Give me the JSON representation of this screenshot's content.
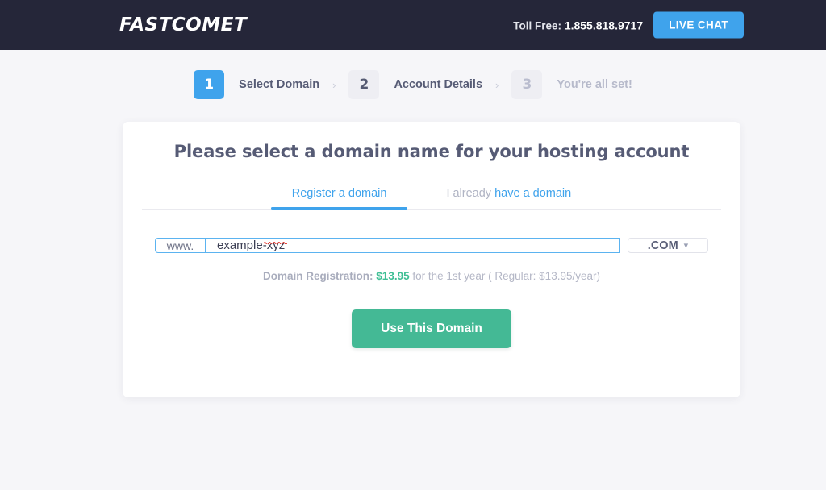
{
  "header": {
    "logo_text": "FASTCOMET",
    "tollfree_label": "Toll Free:",
    "tollfree_number": "1.855.818.9717",
    "live_chat_label": "LIVE CHAT",
    "bar_color": "#252639",
    "accent_blue": "#3fa3ec"
  },
  "steps": [
    {
      "number": "1",
      "label": "Select Domain",
      "state": "active"
    },
    {
      "number": "2",
      "label": "Account Details",
      "state": "idle"
    },
    {
      "number": "3",
      "label": "You're all set!",
      "state": "upcoming"
    }
  ],
  "step_separator": "›",
  "card": {
    "title": "Please select a domain name for your hosting account",
    "tabs": [
      {
        "label": "Register a domain",
        "active": true
      },
      {
        "label_muted": "I already",
        "label_link": "have a domain",
        "active": false
      }
    ],
    "domain_form": {
      "prefix": "www.",
      "value": "example-xyz",
      "placeholder": "",
      "tld_selected": ".COM",
      "tld_chevron": "chevron-down-icon",
      "spellcheck_flagged": true
    },
    "price_line": {
      "label": "Domain Registration:",
      "amount": "$13.95",
      "suffix": "for the 1st year ( Regular: $13.95/year)",
      "amount_color": "#3fbf95"
    },
    "cta_label": "Use This Domain",
    "cta_color": "#44b995"
  }
}
